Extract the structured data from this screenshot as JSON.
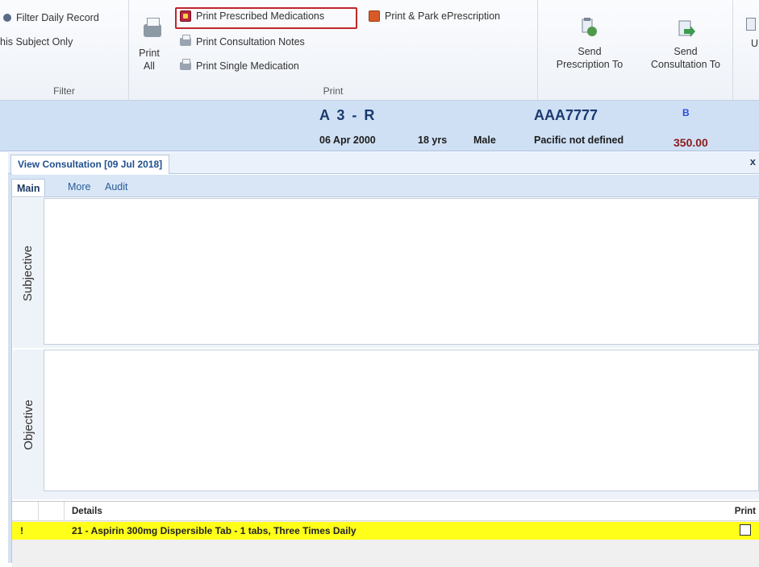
{
  "ribbon": {
    "filter_group": {
      "filter_daily_record": "Filter Daily Record",
      "this_subject_only": "his Subject Only",
      "label": "Filter"
    },
    "print_group": {
      "print_all_line1": "Print",
      "print_all_line2": "All",
      "print_prescribed_medications": "Print Prescribed Medications",
      "print_park_eprescription": "Print & Park ePrescription",
      "print_consultation_notes": "Print Consultation Notes",
      "print_single_medication": "Print Single Medication",
      "label": "Print"
    },
    "send_group": {
      "send_prescription_line1": "Send",
      "send_prescription_line2": "Prescription To",
      "send_consultation_line1": "Send",
      "send_consultation_line2": "Consultation To",
      "cut_off_label": "U"
    }
  },
  "patient": {
    "name": "A 3 -  R",
    "id": "AAA7777",
    "badge": "B",
    "dob": "06 Apr 2000",
    "age": "18 yrs",
    "gender": "Male",
    "ethnicity": "Pacific not defined",
    "amount": "350.00",
    "amount_color": "#8b1a1a"
  },
  "consultation": {
    "tab_title": "View Consultation [09 Jul 2018]",
    "close": "x",
    "subtabs": [
      "Main",
      "More",
      "Audit"
    ],
    "sections": [
      "Subjective",
      "Objective"
    ]
  },
  "grid": {
    "headers": {
      "details": "Details",
      "print": "Print"
    },
    "rows": [
      {
        "marker": "!",
        "details": "21 - Aspirin 300mg Dispersible Tab - 1 tabs, Three Times Daily",
        "print": false
      }
    ],
    "row_highlight_color": "#ffff1a"
  }
}
